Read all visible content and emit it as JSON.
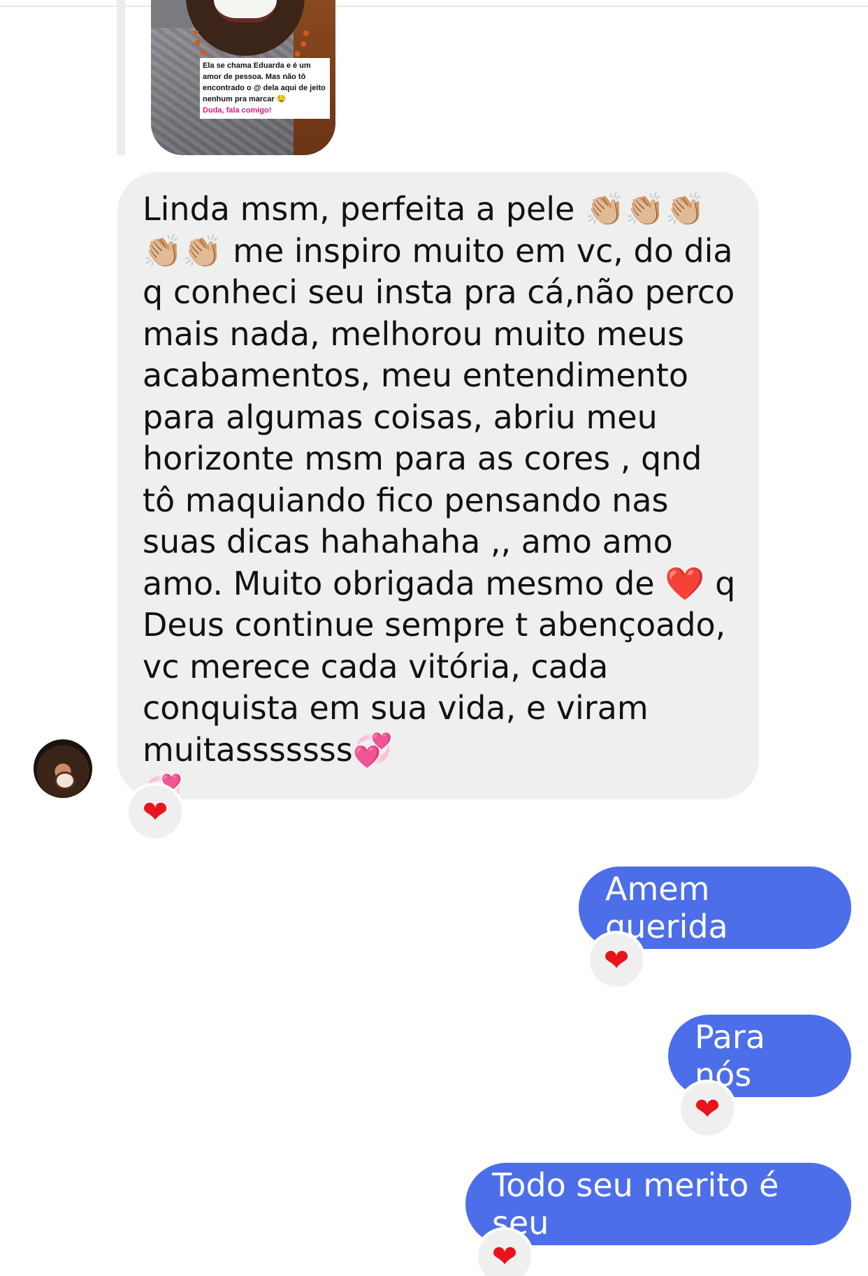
{
  "story_reply": {
    "caption_line1": "Ela se chama Eduarda e é um amor de pessoa. Mas não tô encontrado o @ dela aqui de jeito nenhum pra marcar 🤤",
    "caption_line2": "Duda, fala comigo!"
  },
  "incoming_message": {
    "text": "Linda msm, perfeita a pele 👏🏼👏🏼👏🏼\n👏🏼👏🏼 me inspiro muito em vc, do dia q conheci  seu insta pra cá,não perco mais nada, melhorou muito meus acabamentos, meu entendimento para algumas coisas, abriu meu horizonte msm para as cores , qnd tô maquiando fico pensando nas suas dicas hahahaha ,, amo amo amo. Muito obrigada mesmo de ❤️ q Deus continue sempre t abençoado, vc merece cada vitória, cada conquista em sua vida, e viram muitasssssss💞\n💞",
    "reaction": "❤"
  },
  "outgoing_messages": [
    {
      "text": "Amem querida",
      "reaction": "❤"
    },
    {
      "text": "Para nós",
      "reaction": "❤"
    },
    {
      "text": "Todo seu merito é seu",
      "reaction": "❤"
    }
  ],
  "colors": {
    "incoming_bubble": "#efefef",
    "outgoing_bubble": "#4d6ee9",
    "heart": "#e8141c"
  },
  "icons": {
    "reaction_icon": "red-heart-icon",
    "avatar": "sender-avatar"
  }
}
